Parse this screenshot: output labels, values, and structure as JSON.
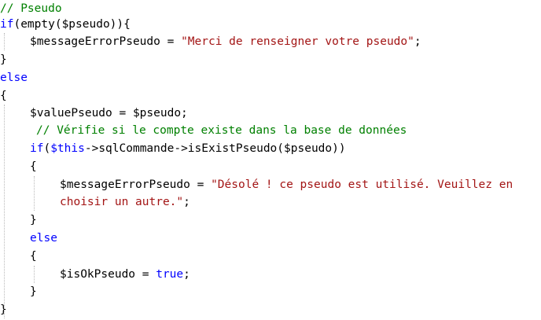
{
  "colors": {
    "background": "#ffffff",
    "comment": "#008000",
    "keyword": "#0000ff",
    "string": "#a31515",
    "plain": "#000000"
  },
  "code_lines": [
    [
      {
        "t": "comment",
        "v": "// Pseudo"
      }
    ],
    [
      {
        "t": "keyword",
        "v": "if"
      },
      {
        "t": "plain",
        "v": "(empty($pseudo)){"
      }
    ],
    [
      {
        "t": "plain",
        "v": "$messageErrorPseudo = "
      },
      {
        "t": "string",
        "v": "\"Merci de renseigner votre pseudo\""
      },
      {
        "t": "plain",
        "v": ";"
      }
    ],
    [
      {
        "t": "plain",
        "v": "}"
      }
    ],
    [
      {
        "t": "keyword",
        "v": "else"
      }
    ],
    [
      {
        "t": "plain",
        "v": "{"
      }
    ],
    [
      {
        "t": "plain",
        "v": "$valuePseudo = $pseudo;"
      }
    ],
    [
      {
        "t": "comment",
        "v": "// Vérifie si le compte existe dans la base de données"
      }
    ],
    [
      {
        "t": "keyword",
        "v": "if"
      },
      {
        "t": "plain",
        "v": "("
      },
      {
        "t": "keyword",
        "v": "$this"
      },
      {
        "t": "plain",
        "v": "->sqlCommande->isExistPseudo($pseudo))"
      }
    ],
    [
      {
        "t": "plain",
        "v": "{"
      }
    ],
    [
      {
        "t": "plain",
        "v": "$messageErrorPseudo = "
      },
      {
        "t": "string",
        "v": "\"Désolé ! ce pseudo est utilisé. Veuillez en"
      }
    ],
    [
      {
        "t": "string",
        "v": "choisir un autre.\""
      },
      {
        "t": "plain",
        "v": ";"
      }
    ],
    [
      {
        "t": "plain",
        "v": "}"
      }
    ],
    [
      {
        "t": "keyword",
        "v": "else"
      }
    ],
    [
      {
        "t": "plain",
        "v": "{"
      }
    ],
    [
      {
        "t": "plain",
        "v": "$isOkPseudo = "
      },
      {
        "t": "keyword",
        "v": "true"
      },
      {
        "t": "plain",
        "v": ";"
      }
    ],
    [
      {
        "t": "plain",
        "v": "}"
      }
    ],
    [
      {
        "t": "plain",
        "v": "}"
      }
    ]
  ]
}
